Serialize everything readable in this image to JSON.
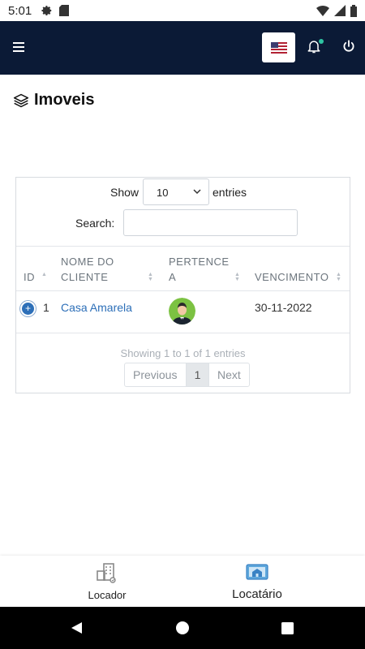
{
  "status_bar": {
    "time": "5:01",
    "icons": [
      "settings-icon",
      "sd-card-icon",
      "wifi-icon",
      "signal-icon",
      "battery-icon"
    ]
  },
  "topbar": {
    "menu_icon": "hamburger-icon",
    "language_icon": "us-flag-icon",
    "notification_icon": "bell-icon",
    "power_icon": "power-icon"
  },
  "page": {
    "title": "Imoveis",
    "title_icon": "layers-icon"
  },
  "table_controls": {
    "show_label": "Show",
    "page_length": "10",
    "entries_label": "entries",
    "search_label": "Search:",
    "search_value": ""
  },
  "table": {
    "headers": [
      "ID",
      "NOME DO CLIENTE",
      "PERTENCE A",
      "VENCIMENTO"
    ],
    "rows": [
      {
        "id": "1",
        "nome_do_cliente": "Casa Amarela",
        "pertence_a": "avatar",
        "vencimento": "30-11-2022"
      }
    ]
  },
  "pagination": {
    "info": "Showing 1 to 1 of 1 entries",
    "previous": "Previous",
    "current": "1",
    "next": "Next"
  },
  "bottom_nav": {
    "items": [
      {
        "label": "Locador",
        "icon": "building-icon"
      },
      {
        "label": "Locatário",
        "icon": "tenant-icon"
      }
    ]
  },
  "colors": {
    "navbar": "#0b1a36",
    "link": "#2d6fb8",
    "notification_dot": "#2ec4a3"
  }
}
